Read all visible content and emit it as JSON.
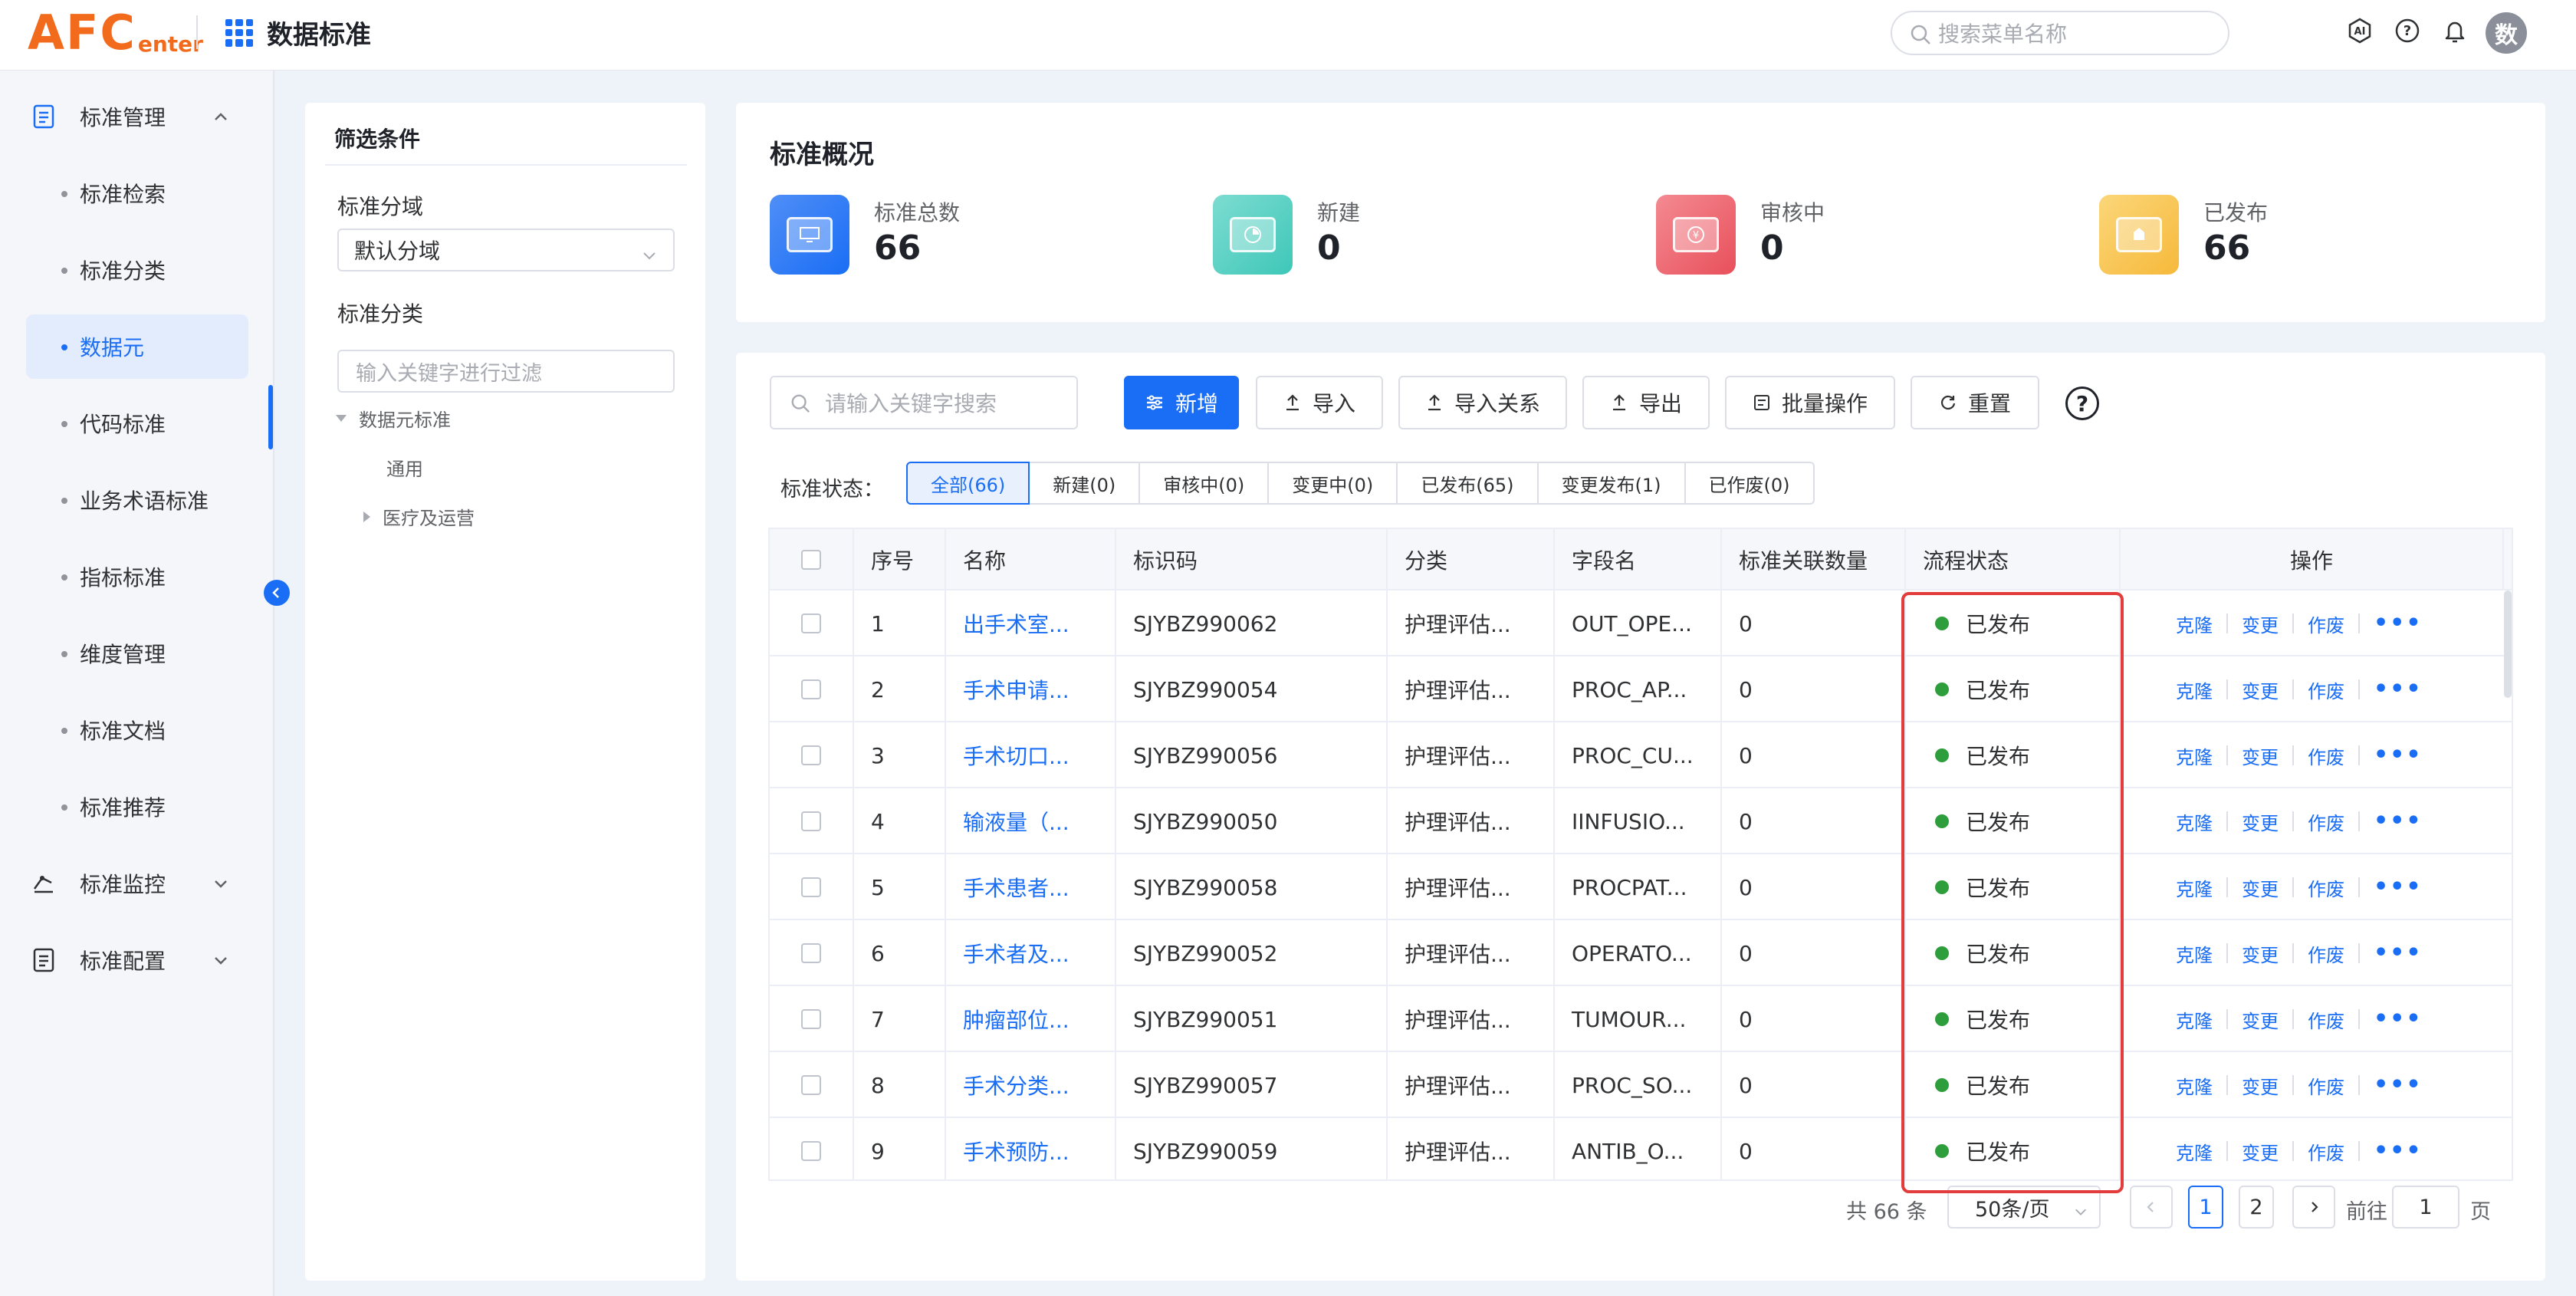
{
  "header": {
    "logo_big": "AFC",
    "logo_small": "enter",
    "app_title": "数据标准",
    "search_placeholder": "搜索菜单名称",
    "avatar_text": "数"
  },
  "sidebar": {
    "groups": [
      {
        "label": "标准管理",
        "expanded": true
      },
      {
        "label": "标准监控",
        "expanded": false
      },
      {
        "label": "标准配置",
        "expanded": false
      }
    ],
    "items": [
      {
        "label": "标准检索"
      },
      {
        "label": "标准分类"
      },
      {
        "label": "数据元",
        "active": true
      },
      {
        "label": "代码标准"
      },
      {
        "label": "业务术语标准"
      },
      {
        "label": "指标标准"
      },
      {
        "label": "维度管理"
      },
      {
        "label": "标准文档"
      },
      {
        "label": "标准推荐"
      }
    ]
  },
  "filter": {
    "title": "筛选条件",
    "domain_label": "标准分域",
    "domain_value": "默认分域",
    "category_label": "标准分类",
    "keyword_placeholder": "输入关键字进行过滤",
    "tree": [
      {
        "label": "数据元标准",
        "expanded": true
      },
      {
        "label": "通用"
      },
      {
        "label": "医疗及运营",
        "expanded": false
      }
    ]
  },
  "overview": {
    "title": "标准概况",
    "stats": [
      {
        "label": "标准总数",
        "value": "66",
        "color": "#1a6ef5"
      },
      {
        "label": "新建",
        "value": "0",
        "color": "#3ec7b8"
      },
      {
        "label": "审核中",
        "value": "0",
        "color": "#e8505b"
      },
      {
        "label": "已发布",
        "value": "66",
        "color": "#f6b93b"
      }
    ]
  },
  "toolbar": {
    "search_placeholder": "请输入关键字搜索",
    "add": "新增",
    "import": "导入",
    "import_rel": "导入关系",
    "export": "导出",
    "batch": "批量操作",
    "reset": "重置",
    "help": "?"
  },
  "status_filter": {
    "label": "标准状态：",
    "tabs": [
      "全部(66)",
      "新建(0)",
      "审核中(0)",
      "变更中(0)",
      "已发布(65)",
      "变更发布(1)",
      "已作废(0)"
    ],
    "active": 0
  },
  "table": {
    "columns": [
      "序号",
      "名称",
      "标识码",
      "分类",
      "字段名",
      "标准关联数量",
      "流程状态",
      "操作"
    ],
    "rows": [
      {
        "no": "1",
        "name": "出手术室...",
        "code": "SJYBZ990062",
        "category": "护理评估...",
        "field": "OUT_OPE...",
        "count": "0",
        "status": "已发布"
      },
      {
        "no": "2",
        "name": "手术申请...",
        "code": "SJYBZ990054",
        "category": "护理评估...",
        "field": "PROC_AP...",
        "count": "0",
        "status": "已发布"
      },
      {
        "no": "3",
        "name": "手术切口...",
        "code": "SJYBZ990056",
        "category": "护理评估...",
        "field": "PROC_CU...",
        "count": "0",
        "status": "已发布"
      },
      {
        "no": "4",
        "name": "输液量（...",
        "code": "SJYBZ990050",
        "category": "护理评估...",
        "field": "IINFUSIO...",
        "count": "0",
        "status": "已发布"
      },
      {
        "no": "5",
        "name": "手术患者...",
        "code": "SJYBZ990058",
        "category": "护理评估...",
        "field": "PROCPAT...",
        "count": "0",
        "status": "已发布"
      },
      {
        "no": "6",
        "name": "手术者及...",
        "code": "SJYBZ990052",
        "category": "护理评估...",
        "field": "OPERATO...",
        "count": "0",
        "status": "已发布"
      },
      {
        "no": "7",
        "name": "肿瘤部位...",
        "code": "SJYBZ990051",
        "category": "护理评估...",
        "field": "TUMOUR...",
        "count": "0",
        "status": "已发布"
      },
      {
        "no": "8",
        "name": "手术分类...",
        "code": "SJYBZ990057",
        "category": "护理评估...",
        "field": "PROC_SO...",
        "count": "0",
        "status": "已发布"
      },
      {
        "no": "9",
        "name": "手术预防...",
        "code": "SJYBZ990059",
        "category": "护理评估...",
        "field": "ANTIB_O...",
        "count": "0",
        "status": "已发布"
      }
    ],
    "actions": [
      "克隆",
      "变更",
      "作废"
    ]
  },
  "pagination": {
    "total": "共 66 条",
    "page_size": "50条/页",
    "pages": [
      "1",
      "2"
    ],
    "current": "1",
    "goto_label": "前往",
    "goto_value": "1",
    "page_suffix": "页"
  }
}
